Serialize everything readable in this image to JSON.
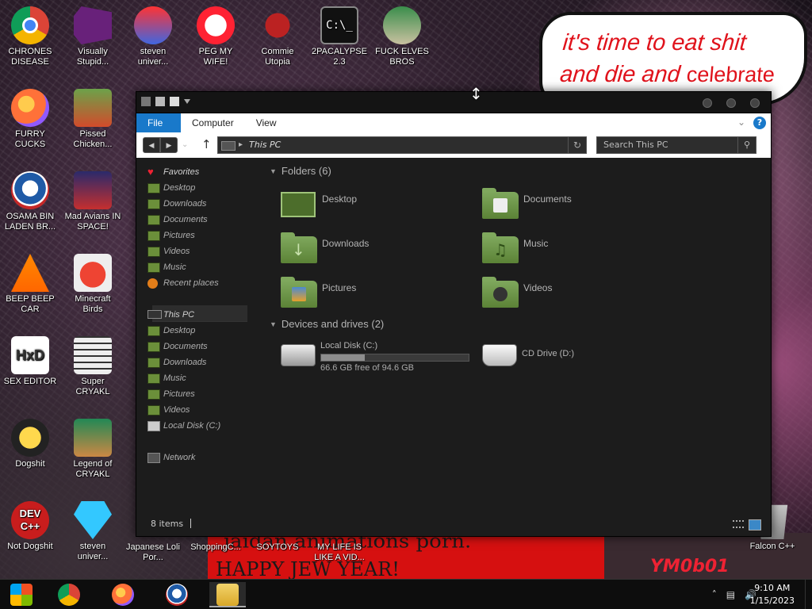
{
  "desktop": {
    "icons": [
      {
        "id": "chrome",
        "label": "CHRONES DISEASE"
      },
      {
        "id": "vs",
        "label": "Visually Stupid..."
      },
      {
        "id": "steven1",
        "label": "steven univer..."
      },
      {
        "id": "peg",
        "label": "PEG MY WIFE!"
      },
      {
        "id": "commie",
        "label": "Commie Utopia"
      },
      {
        "id": "2pac",
        "label": "2PACALYPSE 2.3"
      },
      {
        "id": "elves",
        "label": "FUCK ELVES BROS"
      },
      {
        "id": "firefox",
        "label": "FURRY CUCKS"
      },
      {
        "id": "pissed",
        "label": "Pissed Chicken..."
      },
      {
        "id": "osama",
        "label": "OSAMA BIN LADEN BR..."
      },
      {
        "id": "mad",
        "label": "Mad Avians IN SPACE!"
      },
      {
        "id": "beep",
        "label": "BEEP BEEP CAR"
      },
      {
        "id": "mcbirds",
        "label": "Minecraft Birds"
      },
      {
        "id": "sexeditor",
        "label": "SEX EDITOR"
      },
      {
        "id": "supercryakl",
        "label": "Super CRYAKL"
      },
      {
        "id": "dogshit",
        "label": "Dogshit"
      },
      {
        "id": "legend",
        "label": "Legend of CRYAKL"
      },
      {
        "id": "notdog",
        "label": "Not Dogshit"
      },
      {
        "id": "steven2",
        "label": "steven univer..."
      },
      {
        "id": "japanese",
        "label": "Japanese Loli Por..."
      },
      {
        "id": "shopping",
        "label": "ShoppingC..."
      },
      {
        "id": "soytoys",
        "label": "SOYTOYS"
      },
      {
        "id": "mylife",
        "label": "MY LIFE IS LIKE A VID..."
      },
      {
        "id": "falcon",
        "label": "Falcon C++"
      }
    ],
    "icon_glyphs": {
      "cmd": "C:\\_",
      "hxd": "HxD",
      "dev": "DEV C++"
    },
    "bubble_line1": "it's time to eat shit",
    "bubble_line2a": "and die and",
    "bubble_line2b": "celebrate",
    "banner_line1": "jaidan animations porn.",
    "banner_line2": "HAPPY JEW YEAR!",
    "signature": "YM0b01"
  },
  "window": {
    "tabs": [
      "File",
      "Computer",
      "View"
    ],
    "address_path": "This PC",
    "search_placeholder": "Search This PC",
    "nav": {
      "favorites_label": "Favorites",
      "favorites": [
        "Desktop",
        "Downloads",
        "Documents",
        "Pictures",
        "Videos",
        "Music",
        "Recent places"
      ],
      "thispc_label": "This PC",
      "thispc": [
        "Desktop",
        "Documents",
        "Downloads",
        "Music",
        "Pictures",
        "Videos",
        "Local Disk (C:)"
      ],
      "network_label": "Network"
    },
    "folders_title": "Folders (6)",
    "folders": [
      "Desktop",
      "Documents",
      "Downloads",
      "Music",
      "Pictures",
      "Videos"
    ],
    "drives_title": "Devices and drives (2)",
    "drives": [
      {
        "name": "Local Disk (C:)",
        "free": "66.6 GB free of 94.6 GB",
        "used_fraction": 0.296
      },
      {
        "name": "CD Drive (D:)"
      }
    ],
    "status": "8 items"
  },
  "taskbar": {
    "time": "9:10 AM",
    "date": "1/15/2023"
  },
  "colors": {
    "accent": "#1979ca",
    "folder": "#6b8f3a"
  }
}
